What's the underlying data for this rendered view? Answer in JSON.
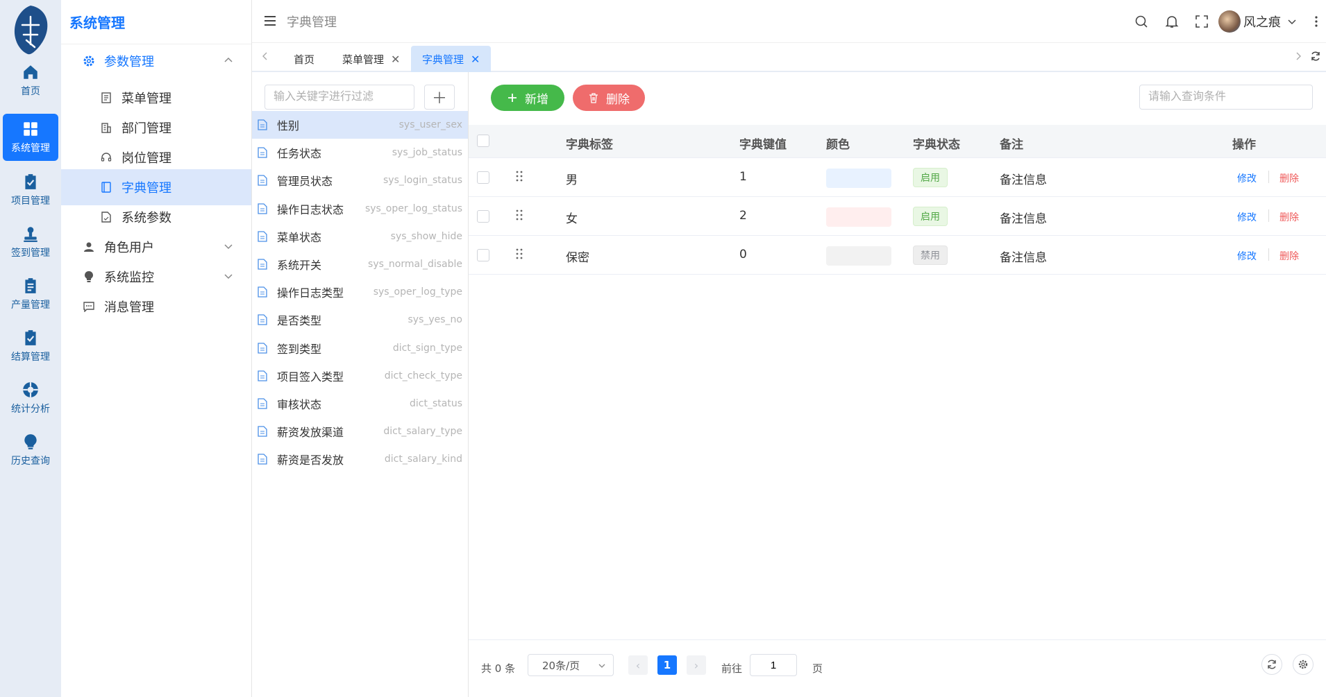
{
  "rail": {
    "items": [
      {
        "label": "首页",
        "icon": "home-icon"
      },
      {
        "label": "系统管理",
        "icon": "grid-icon",
        "active": true
      },
      {
        "label": "项目管理",
        "icon": "clipboard-check-icon"
      },
      {
        "label": "签到管理",
        "icon": "stamp-icon"
      },
      {
        "label": "产量管理",
        "icon": "clipboard-list-icon"
      },
      {
        "label": "结算管理",
        "icon": "clipboard-check-icon"
      },
      {
        "label": "统计分析",
        "icon": "pie-chart-icon"
      },
      {
        "label": "历史查询",
        "icon": "bulb-icon"
      }
    ]
  },
  "sidebar": {
    "title": "系统管理",
    "items": [
      {
        "label": "参数管理",
        "icon": "gear-icon"
      },
      {
        "label": "菜单管理",
        "icon": "doc-icon"
      },
      {
        "label": "部门管理",
        "icon": "building-icon"
      },
      {
        "label": "岗位管理",
        "icon": "headset-icon"
      },
      {
        "label": "字典管理",
        "icon": "book-icon"
      },
      {
        "label": "系统参数",
        "icon": "file-icon"
      },
      {
        "label": "角色用户",
        "icon": "user-icon"
      },
      {
        "label": "系统监控",
        "icon": "bulb-icon"
      },
      {
        "label": "消息管理",
        "icon": "chat-icon"
      }
    ]
  },
  "header": {
    "breadcrumb": "字典管理",
    "user": "风之痕"
  },
  "tabs": [
    {
      "label": "首页"
    },
    {
      "label": "菜单管理"
    },
    {
      "label": "字典管理"
    }
  ],
  "dict": {
    "filter_placeholder": "输入关键字进行过滤",
    "items": [
      {
        "label": "性别",
        "code": "sys_user_sex"
      },
      {
        "label": "任务状态",
        "code": "sys_job_status"
      },
      {
        "label": "管理员状态",
        "code": "sys_login_status"
      },
      {
        "label": "操作日志状态",
        "code": "sys_oper_log_status"
      },
      {
        "label": "菜单状态",
        "code": "sys_show_hide"
      },
      {
        "label": "系统开关",
        "code": "sys_normal_disable"
      },
      {
        "label": "操作日志类型",
        "code": "sys_oper_log_type"
      },
      {
        "label": "是否类型",
        "code": "sys_yes_no"
      },
      {
        "label": "签到类型",
        "code": "dict_sign_type"
      },
      {
        "label": "项目签入类型",
        "code": "dict_check_type"
      },
      {
        "label": "审核状态",
        "code": "dict_status"
      },
      {
        "label": "薪资发放渠道",
        "code": "dict_salary_type"
      },
      {
        "label": "薪资是否发放",
        "code": "dict_salary_kind"
      }
    ]
  },
  "toolbar": {
    "add_label": "新增",
    "delete_label": "删除",
    "query_placeholder": "请输入查询条件"
  },
  "table": {
    "headers": {
      "label": "字典标签",
      "value": "字典键值",
      "color": "颜色",
      "status": "字典状态",
      "remark": "备注",
      "action": "操作"
    },
    "rows": [
      {
        "label": "男",
        "value": "1",
        "color": "#e8f2ff",
        "status": "启用",
        "remark": "备注信息"
      },
      {
        "label": "女",
        "value": "2",
        "color": "#ffeeee",
        "status": "启用",
        "remark": "备注信息"
      },
      {
        "label": "保密",
        "value": "0",
        "color": "#f2f2f2",
        "status": "禁用",
        "remark": "备注信息"
      }
    ],
    "edit_label": "修改",
    "delete_label": "删除"
  },
  "pagination": {
    "total": "共 0 条",
    "page_size": "20条/页",
    "current": "1",
    "goto_label": "前往",
    "goto_value": "1",
    "page_label": "页"
  }
}
